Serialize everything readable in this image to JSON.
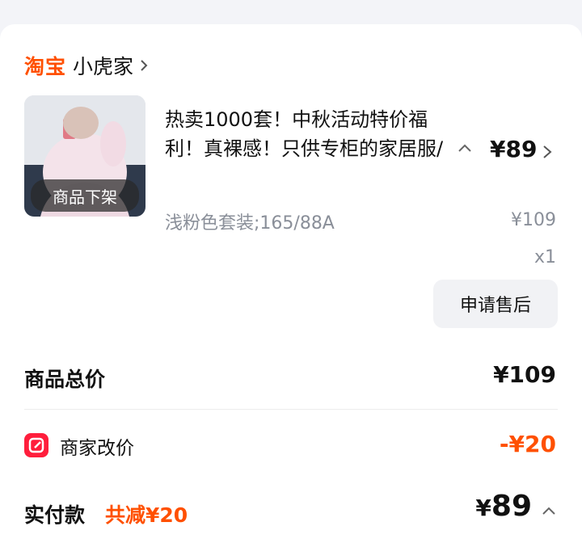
{
  "shop": {
    "platform": "淘宝",
    "name": "小虎家"
  },
  "product": {
    "thumb_label": "商品下架",
    "title": "热卖1000套！中秋活动特价福利！真裸感！只供专柜的家居服/",
    "price": "¥89",
    "sku": "浅粉色套装;165/88A",
    "original_price": "¥109",
    "quantity": "x1",
    "after_sale_label": "申请售后"
  },
  "summary": {
    "total_label": "商品总价",
    "total_value": "¥109",
    "discount_label": "商家改价",
    "discount_value": "-¥20",
    "paid_label": "实付款",
    "saved_text": "共减¥20",
    "paid_yen": "¥",
    "paid_value": "89"
  },
  "colors": {
    "accent": "#ff5000",
    "discount_icon": "#ff1e3c"
  },
  "icons": {
    "shop_chevron": "chevron-right-icon",
    "title_toggle": "chevron-up-icon",
    "price_chevron": "chevron-right-icon",
    "discount": "edit-price-icon",
    "paid_toggle": "chevron-up-icon"
  }
}
